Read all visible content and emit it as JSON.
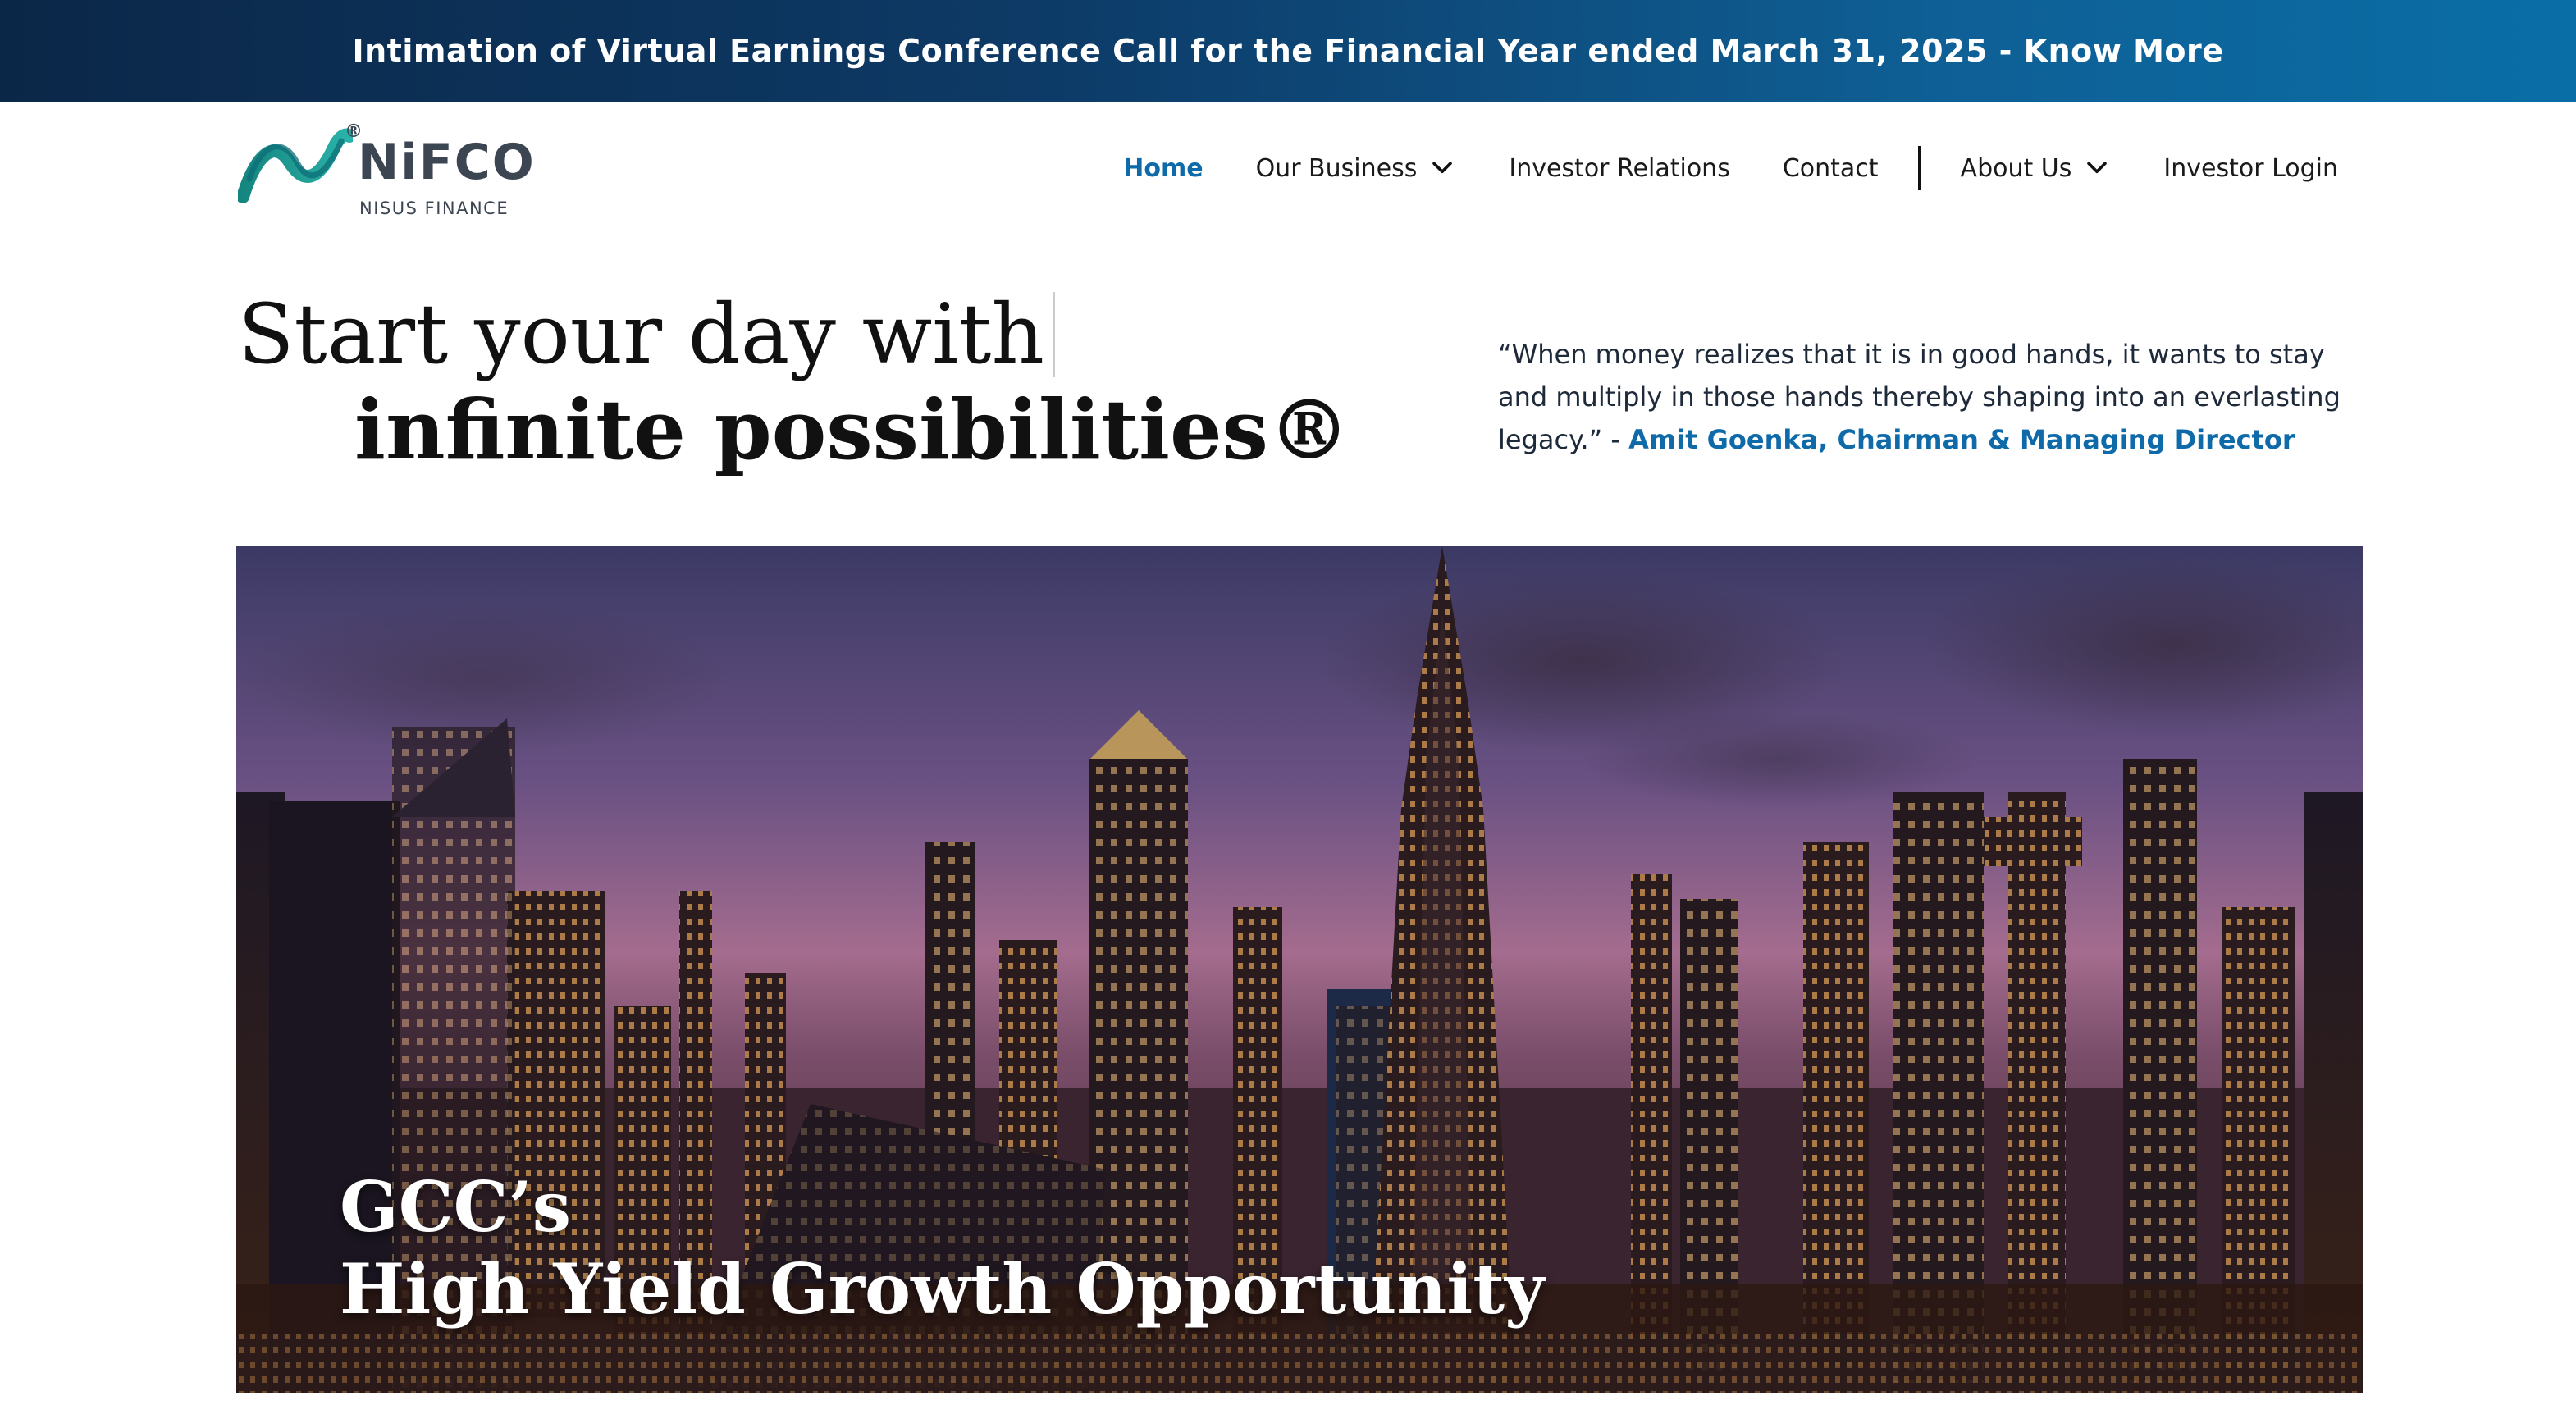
{
  "announcement": {
    "text": "Intimation of Virtual Earnings Conference Call for the Financial Year ended March 31, 2025 - Know More"
  },
  "logo": {
    "name": "NiFCO",
    "subtitle": "NISUS FINANCE",
    "registered": "®"
  },
  "nav": {
    "items": [
      {
        "label": "Home",
        "active": true
      },
      {
        "label": "Our Business",
        "dropdown": true
      },
      {
        "label": "Investor Relations"
      },
      {
        "label": "Contact"
      },
      {
        "label": "About Us",
        "dropdown": true
      },
      {
        "label": "Investor Login"
      }
    ]
  },
  "hero": {
    "line1": "Start your day with",
    "line2": "infinite possibilities®"
  },
  "quote": {
    "text": "“When money realizes that it is in good hands, it wants to stay and multiply in those hands thereby shaping into an everlasting legacy.” - ",
    "author": "Amit Goenka, Chairman & Managing Director"
  },
  "banner": {
    "line1": "GCC’s",
    "line2": "High Yield Growth Opportunity"
  },
  "colors": {
    "accent": "#0e6aa8",
    "announcement_start": "#0b2748",
    "announcement_end": "#0a6ea6",
    "logo_teal": "#1a9a96"
  }
}
